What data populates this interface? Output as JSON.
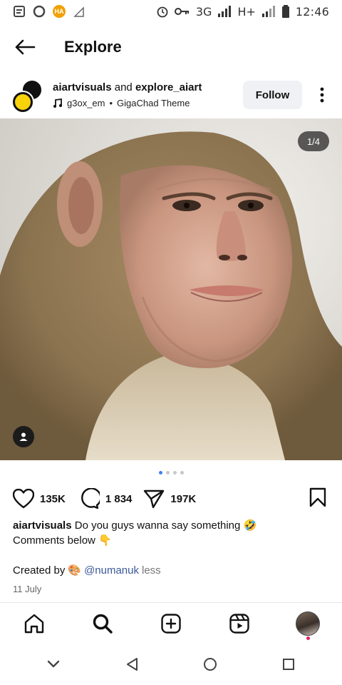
{
  "status_bar": {
    "time": "12:46",
    "network": "3G",
    "network2": "H+",
    "badge": "HA",
    "icons": [
      "notes-icon",
      "chat-icon",
      "signal-icon",
      "alarm-icon",
      "key-icon",
      "signal-bars-icon",
      "battery-icon"
    ]
  },
  "header": {
    "title": "Explore",
    "back_icon": "arrow-left-icon"
  },
  "post": {
    "author_primary": "aiartvisuals",
    "author_join": " and ",
    "author_secondary": "explore_aiart",
    "audio_user": "g3ox_em",
    "audio_sep": " • ",
    "audio_track": "GigaChad Theme",
    "follow_label": "Follow",
    "media_counter": "1/4",
    "media_subject": "monkey-with-human-face",
    "carousel": {
      "count": 4,
      "active_index": 0
    }
  },
  "actions": {
    "likes": "135K",
    "comments": "1 834",
    "shares": "197K"
  },
  "caption": {
    "username": "aiartvisuals",
    "text": " Do you guys wanna say something 🤣",
    "line2": "Comments below 👇"
  },
  "credit": {
    "prefix": "Created by",
    "mention": "@numanuk",
    "more": "less"
  },
  "date": "11 July",
  "colors": {
    "accent": "#3b82f6",
    "follow_bg": "#eff1f4",
    "notification_dot": "#e0245e"
  }
}
